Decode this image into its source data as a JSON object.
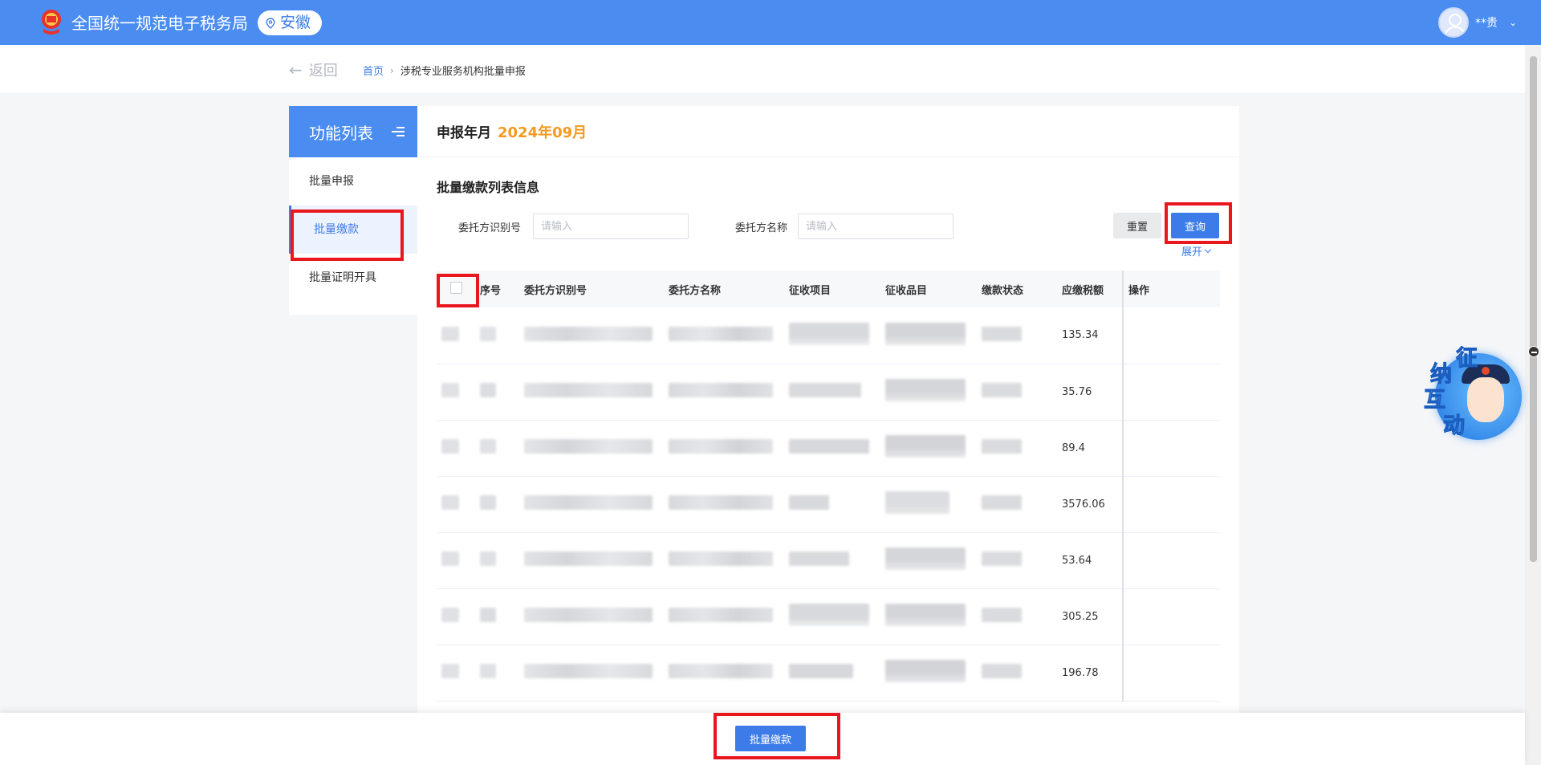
{
  "header": {
    "site_title": "全国统一规范电子税务局",
    "region": "安徽",
    "user_name": "**贵"
  },
  "nav": {
    "back_label": "返回",
    "breadcrumb_home": "首页",
    "breadcrumb_current": "涉税专业服务机构批量申报"
  },
  "sidebar": {
    "title": "功能列表",
    "items": [
      {
        "label": "批量申报"
      },
      {
        "label": "批量缴款"
      },
      {
        "label": "批量证明开具"
      }
    ],
    "active_index": 1
  },
  "main": {
    "period_label": "申报年月",
    "period_value": "2024年09月",
    "section_title": "批量缴款列表信息",
    "filters": {
      "client_id_label": "委托方识别号",
      "client_id_placeholder": "请输入",
      "client_name_label": "委托方名称",
      "client_name_placeholder": "请输入"
    },
    "reset_label": "重置",
    "query_label": "查询",
    "expand_label": "展开"
  },
  "table": {
    "columns": [
      "序号",
      "委托方识别号",
      "委托方名称",
      "征收项目",
      "征收品目",
      "缴款状态",
      "应缴税额",
      "操作"
    ],
    "rows": [
      {
        "amount": "135.34"
      },
      {
        "amount": "35.76"
      },
      {
        "amount": "89.4"
      },
      {
        "amount": "3576.06"
      },
      {
        "amount": "53.64"
      },
      {
        "amount": "305.25"
      },
      {
        "amount": "196.78"
      }
    ]
  },
  "footer": {
    "batch_pay_label": "批量缴款"
  },
  "assistant": {
    "chars": [
      "征",
      "纳",
      "互",
      "动"
    ]
  },
  "colors": {
    "primary": "#4a8cf0",
    "accent_orange": "#f39a1f",
    "highlight_red": "#e8161d"
  }
}
